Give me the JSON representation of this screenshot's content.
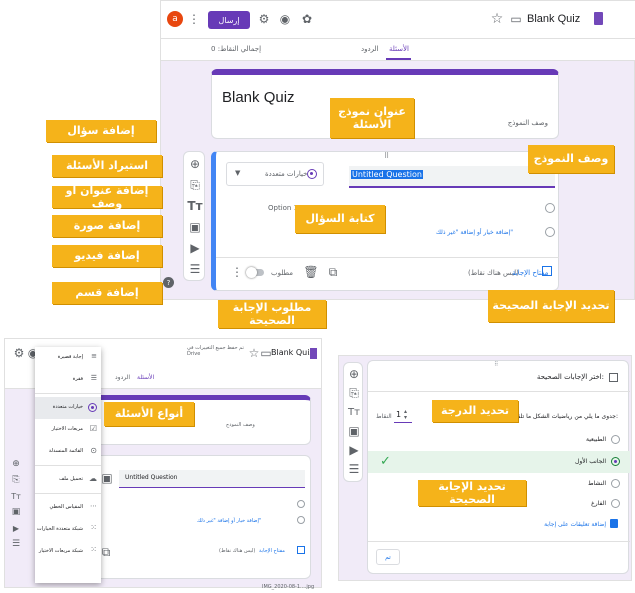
{
  "top_panel": {
    "title": "Blank Quiz",
    "send_button": "إرسال",
    "avatar_letter": "a",
    "tab_questions": "الأسئلة",
    "tab_responses": "الردود",
    "total_points": "إجمالي النقاط: 0",
    "form_title": "Blank Quiz",
    "form_description": "وصف النموذج",
    "question_title": "Untitled Question",
    "question_type": "خيارات متعددة",
    "option1": "Option 1",
    "add_option": "إضافة خيار أو إضافة \"غير ذلك\"",
    "answer_key": "مفتاح الإجابة",
    "answer_key_points": "(ليس هناك نقاط)",
    "required_label": "مطلوب",
    "drag_handle": "⠿"
  },
  "callouts": {
    "add_question": "إضافة سؤال",
    "import_questions": "استيراد الأسئلة",
    "add_title_desc": "إضافة عنوان أو وصف",
    "add_image": "إضافة صورة",
    "add_video": "إضافة فيديو",
    "add_section": "إضافة قسم",
    "quiz_title": "عنوان نموذج الأسئلة",
    "form_description": "وصف النموذج",
    "write_question": "كتابة السؤال",
    "set_correct_answer": "تحديد الإجابة الصحيحة",
    "correct_answer_required": "مطلوب الإجابة الصحيحة",
    "question_types": "أنواع الأسئلة",
    "set_points": "تحديد الدرجة",
    "set_correct_answer_2": "تحديد الإجابة الصحيحة"
  },
  "bottom_left": {
    "title": "Blank Quiz",
    "header_text": "تم حفظ جميع التغييرات في Drive",
    "tab_questions": "الأسئلة",
    "tab_responses": "الردود",
    "form_description": "وصف النموذج",
    "question_title": "Untitled Question",
    "add_option": "إضافة خيار أو إضافة \"غير ذلك\"",
    "answer_key": "مفتاح الإجابة",
    "answer_key_points": "(ليس هناك نقاط)",
    "menu_items": [
      "إجابة قصيرة",
      "فقرة",
      "خيارات متعددة",
      "مربعات الاختيار",
      "القائمة المنسدلة",
      "تحميل ملف",
      "المقياس الخطي",
      "شبكة متعددة الخيارات",
      "شبكة مربعات الاختيار"
    ],
    "footer_file": "IMG_2020-08-1....jpg"
  },
  "bottom_right": {
    "heading": "اختر الإجابات الصحيحة:",
    "question": "جدوى ما يلي من رياضيات الشكل ما تلقا:",
    "points_value": "1",
    "points_label": "النقاط",
    "options": [
      "الطبيعية",
      "الجانب الأول",
      "النشاط",
      "الفارغ"
    ],
    "add_feedback": "إضافة تعليقات على إجابة",
    "done_button": "تم",
    "checkmark": "✓"
  }
}
